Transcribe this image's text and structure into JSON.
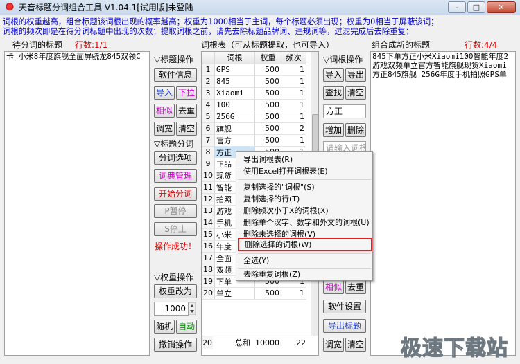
{
  "window": {
    "title": "天音标题分词组合工具 V1.04.1[试用版]未登陆"
  },
  "info": {
    "line1": "词根的权重越高，组合标题该词根出现的概率越高；权重为1000相当于主词，每个标题必须出现；权重为0相当于屏蔽该词；",
    "line2": "词根的频次即是在待分词标题中出现的次数；提取词根之前，请先去除标题品牌词、违规词等，过滤完成后去除重复；"
  },
  "left_panel": {
    "title": "待分词的标题",
    "count_label": "行数:1/1",
    "lines": [
      "卡 小米8年度旗舰全面屏骁龙845双领C"
    ]
  },
  "title_ops": {
    "heading": "▽标题操作",
    "software_info": "软件信息",
    "import": "导入",
    "dropdown": "下拉",
    "similar": "相似",
    "dedupe": "去重",
    "adjust_width": "调宽",
    "clear": "清空"
  },
  "segment_ops": {
    "heading": "▽标题分词",
    "options": "分词选项",
    "dictionary": "词典管理",
    "start": "开始分词",
    "pause": "P暂停",
    "stop": "S停止",
    "status": "操作成功！"
  },
  "weight_ops": {
    "heading": "▽权重操作",
    "set_weight": "权重改为",
    "weight_value": "1000",
    "random": "随机",
    "auto": "自动",
    "undo": "撤销操作"
  },
  "table": {
    "title": "词根表（可从标题提取，也可导入）",
    "headers": [
      "词根",
      "权重",
      "频次"
    ],
    "rows": [
      {
        "idx": "1",
        "word": "GPS",
        "weight": "500",
        "freq": "1"
      },
      {
        "idx": "2",
        "word": "845",
        "weight": "500",
        "freq": "1"
      },
      {
        "idx": "3",
        "word": "Xiaomi",
        "weight": "500",
        "freq": "1"
      },
      {
        "idx": "4",
        "word": "100",
        "weight": "500",
        "freq": "1"
      },
      {
        "idx": "5",
        "word": "256G",
        "weight": "500",
        "freq": "1"
      },
      {
        "idx": "6",
        "word": "旗舰",
        "weight": "500",
        "freq": "2"
      },
      {
        "idx": "7",
        "word": "官方",
        "weight": "500",
        "freq": "1"
      },
      {
        "idx": "8",
        "word": "方正",
        "weight": "500",
        "freq": "1"
      },
      {
        "idx": "9",
        "word": "正品",
        "weight": "",
        "freq": ""
      },
      {
        "idx": "10",
        "word": "现货",
        "weight": "",
        "freq": ""
      },
      {
        "idx": "11",
        "word": "智能",
        "weight": "",
        "freq": ""
      },
      {
        "idx": "12",
        "word": "拍照",
        "weight": "",
        "freq": ""
      },
      {
        "idx": "13",
        "word": "游戏",
        "weight": "",
        "freq": ""
      },
      {
        "idx": "14",
        "word": "手机",
        "weight": "",
        "freq": ""
      },
      {
        "idx": "15",
        "word": "小米",
        "weight": "",
        "freq": ""
      },
      {
        "idx": "16",
        "word": "年度",
        "weight": "",
        "freq": ""
      },
      {
        "idx": "17",
        "word": "全面",
        "weight": "",
        "freq": ""
      },
      {
        "idx": "18",
        "word": "双频",
        "weight": "",
        "freq": ""
      },
      {
        "idx": "19",
        "word": "下单",
        "weight": "500",
        "freq": "1"
      },
      {
        "idx": "20",
        "word": "单立",
        "weight": "500",
        "freq": "1"
      }
    ],
    "footer": {
      "idx": "20",
      "label": "总和",
      "weight": "10000",
      "freq": "22"
    }
  },
  "root_ops": {
    "heading": "▽词根操作",
    "import": "导入",
    "export": "导出",
    "find": "查找",
    "clear": "清空",
    "search_value": "方正",
    "add": "增加",
    "delete": "删除",
    "input_placeholder": "请输入词根",
    "similar": "相似",
    "dedupe": "去重",
    "settings": "软件设置",
    "export_titles": "导出标题",
    "adjust_width": "调宽",
    "clear2": "清空"
  },
  "right_panel": {
    "title": "组合成新的标题",
    "count_label": "行数:4/4",
    "lines": [
      "845下单方正小米Xiaomi100智能年度2",
      "游戏双频单立官方智能旗舰现货Xiaomi",
      "方正845旗舰 256G年度手机拍照GPS单"
    ]
  },
  "context_menu": {
    "items": [
      "导出词根表(R)",
      "使用Excel打开词根表(E)",
      "复制选择的\"词根\"(S)",
      "复制选择的行(T)",
      "删除频次小于X的词根(X)",
      "删除单个汉字、数字和外文的词根(U)",
      "删除未选择的词根(V)",
      "删除选择的词根(W)",
      "全选(Y)",
      "去除重复词根(Z)"
    ]
  },
  "watermark": "极速下载站"
}
